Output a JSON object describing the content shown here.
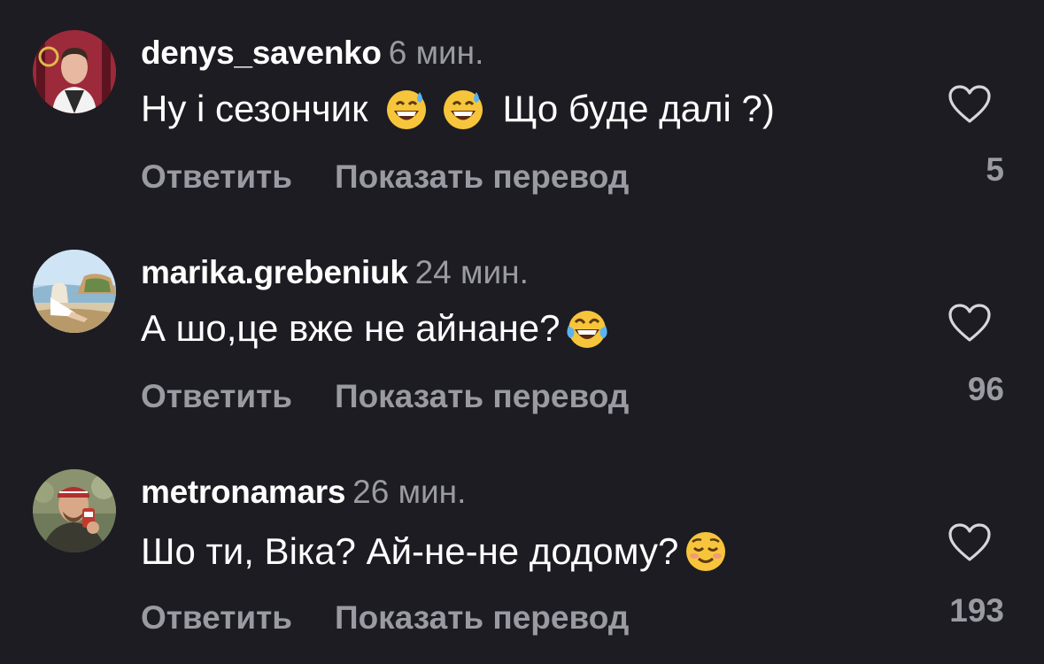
{
  "comments": [
    {
      "username": "denys_savenko",
      "time": "6 мин.",
      "text_before": "Ну і сезончик",
      "text_after": "Що буде далі ?)",
      "emojis": [
        "grinning-sweat-emoji",
        "grinning-sweat-emoji"
      ],
      "reply_label": "Ответить",
      "translate_label": "Показать перевод",
      "likes": "5"
    },
    {
      "username": "marika.grebeniuk",
      "time": "24 мин.",
      "text_before": "А шо,це вже не айнане?",
      "emojis": [
        "tears-of-joy-emoji"
      ],
      "reply_label": "Ответить",
      "translate_label": "Показать перевод",
      "likes": "96"
    },
    {
      "username": "metronamars",
      "time": "26 мин.",
      "text_before": "Шо ти, Віка? Ай-не-не додому?",
      "emojis": [
        "smiling-blushing-emoji"
      ],
      "reply_label": "Ответить",
      "translate_label": "Показать перевод",
      "likes": "193"
    }
  ],
  "colors": {
    "background": "#1c1c22",
    "primary_text": "#ffffff",
    "secondary_text": "#9a9aa2"
  }
}
